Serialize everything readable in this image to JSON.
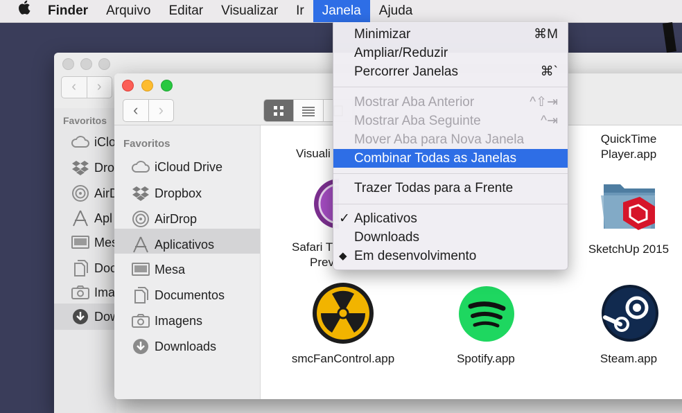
{
  "menubar": {
    "items": [
      {
        "label": "Finder",
        "bold": true
      },
      {
        "label": "Arquivo"
      },
      {
        "label": "Editar"
      },
      {
        "label": "Visualizar"
      },
      {
        "label": "Ir"
      },
      {
        "label": "Janela",
        "active": true
      },
      {
        "label": "Ajuda"
      }
    ]
  },
  "janela_menu": {
    "group1": [
      {
        "label": "Minimizar",
        "shortcut": "⌘M"
      },
      {
        "label": "Ampliar/Reduzir",
        "shortcut": ""
      },
      {
        "label": "Percorrer Janelas",
        "shortcut": "⌘`"
      }
    ],
    "group2": [
      {
        "label": "Mostrar Aba Anterior",
        "shortcut": "^⇧⇥",
        "disabled": true
      },
      {
        "label": "Mostrar Aba Seguinte",
        "shortcut": "^⇥",
        "disabled": true
      },
      {
        "label": "Mover Aba para Nova Janela",
        "shortcut": "",
        "disabled": true
      },
      {
        "label": "Combinar Todas as Janelas",
        "shortcut": "",
        "highlighted": true
      }
    ],
    "group3": [
      {
        "label": "Trazer Todas para a Frente"
      }
    ],
    "group4": [
      {
        "label": "Aplicativos",
        "mark": "✓"
      },
      {
        "label": "Downloads",
        "mark": ""
      },
      {
        "label": "Em desenvolvimento",
        "mark": "◆"
      }
    ]
  },
  "back_window": {
    "sidebar_heading": "Favoritos",
    "sidebar_items": [
      "iClo",
      "Dro",
      "AirD",
      "Apl",
      "Mes",
      "Doc",
      "Imag",
      "Dow"
    ]
  },
  "front_window": {
    "sidebar_heading": "Favoritos",
    "sidebar_items": [
      {
        "label": "iCloud Drive",
        "icon": "cloud-icon"
      },
      {
        "label": "Dropbox",
        "icon": "dropbox-icon"
      },
      {
        "label": "AirDrop",
        "icon": "airdrop-icon"
      },
      {
        "label": "Aplicativos",
        "icon": "applications-icon",
        "selected": true
      },
      {
        "label": "Mesa",
        "icon": "desktop-icon"
      },
      {
        "label": "Documentos",
        "icon": "documents-icon"
      },
      {
        "label": "Imagens",
        "icon": "camera-icon"
      },
      {
        "label": "Downloads",
        "icon": "downloads-icon"
      }
    ],
    "apps": {
      "visuali": "Visuali",
      "quicktime_line1": "QuickTime",
      "quicktime_line2": "Player.app",
      "safari_line1": "Safari T",
      "safari_line2": "Prev",
      "sketchup": "SketchUp 2015",
      "smcfan": "smcFanControl.app",
      "spotify": "Spotify.app",
      "steam": "Steam.app"
    }
  }
}
